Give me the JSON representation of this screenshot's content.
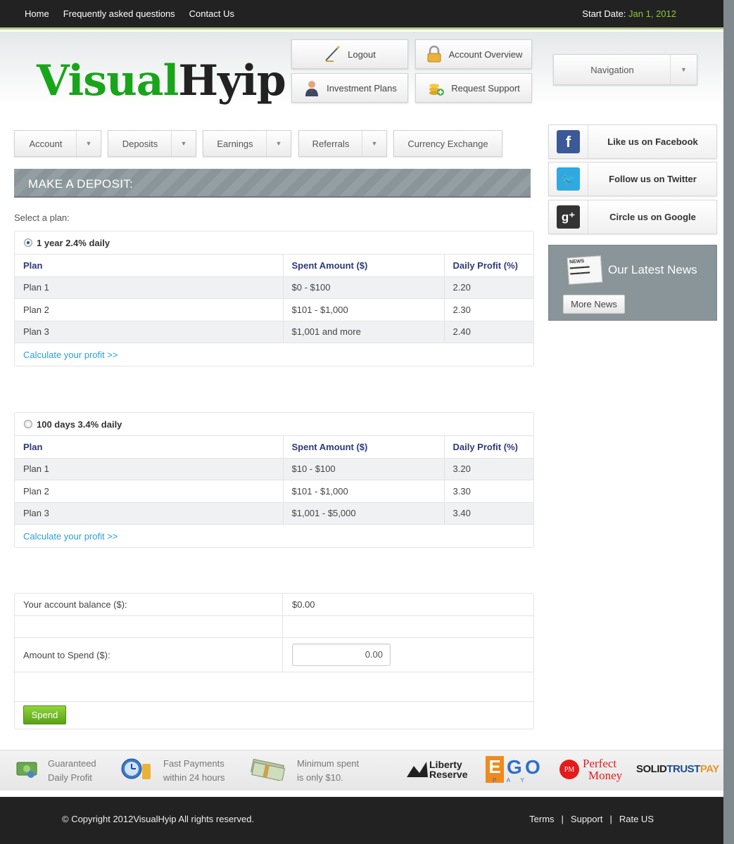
{
  "topbar": {
    "nav": [
      "Home",
      "Frequently asked questions",
      "Contact Us"
    ],
    "start_label": "Start Date:",
    "start_value": "Jan 1, 2012"
  },
  "logo": {
    "part1": "Visual",
    "part2": "Hyip"
  },
  "header_buttons": {
    "logout": "Logout",
    "account_overview": "Account Overview",
    "investment_plans": "Investment Plans",
    "request_support": "Request Support"
  },
  "navigation_dropdown": "Navigation",
  "menu": {
    "account": "Account",
    "deposits": "Deposits",
    "earnings": "Earnings",
    "referrals": "Referrals",
    "currency_exchange": "Currency Exchange"
  },
  "section_title": "MAKE A DEPOSIT:",
  "select_plan_label": "Select a plan:",
  "plans": [
    {
      "title": "1 year 2.4% daily",
      "selected": true,
      "headers": [
        "Plan",
        "Spent Amount ($)",
        "Daily Profit (%)"
      ],
      "rows": [
        [
          "Plan 1",
          "$0 - $100",
          "2.20"
        ],
        [
          "Plan 2",
          "$101 - $1,000",
          "2.30"
        ],
        [
          "Plan 3",
          "$1,001 and more",
          "2.40"
        ]
      ],
      "calc_link": "Calculate your profit >>"
    },
    {
      "title": "100 days 3.4% daily",
      "selected": false,
      "headers": [
        "Plan",
        "Spent Amount ($)",
        "Daily Profit (%)"
      ],
      "rows": [
        [
          "Plan 1",
          "$10 - $100",
          "3.20"
        ],
        [
          "Plan 2",
          "$101 - $1,000",
          "3.30"
        ],
        [
          "Plan 3",
          "$1,001 - $5,000",
          "3.40"
        ]
      ],
      "calc_link": "Calculate your profit >>"
    }
  ],
  "balance": {
    "balance_label": "Your account balance ($):",
    "balance_value": "$0.00",
    "amount_label": "Amount to Spend ($):",
    "amount_value": "0.00",
    "spend_button": "Spend"
  },
  "sidebar": {
    "facebook": "Like us on Facebook",
    "twitter": "Follow us on Twitter",
    "google": "Circle us on Google",
    "news_title": "Our Latest News",
    "more_news": "More News",
    "news_icon_text": "NEWS"
  },
  "features": [
    {
      "line1": "Guaranteed",
      "line2": "Daily Profit"
    },
    {
      "line1": "Fast Payments",
      "line2": "within 24 hours"
    },
    {
      "line1": "Minimum spent",
      "line2": "is only $10."
    }
  ],
  "payment_logos": {
    "liberty1": "Liberty",
    "liberty2": "Reserve",
    "ego_e": "E",
    "ego_g": "G",
    "ego_o": "O",
    "ego_pay": "PAY",
    "pm_badge": "PM",
    "pm1": "Perfect",
    "pm2": "Money",
    "stp1": "SOLID",
    "stp2": "TRUST",
    "stp3": "PAY"
  },
  "footer": {
    "copyright": "© Copyright 2012VisualHyip All rights reserved.",
    "links": [
      "Terms",
      "Support",
      "Rate US"
    ],
    "separator": "|"
  }
}
